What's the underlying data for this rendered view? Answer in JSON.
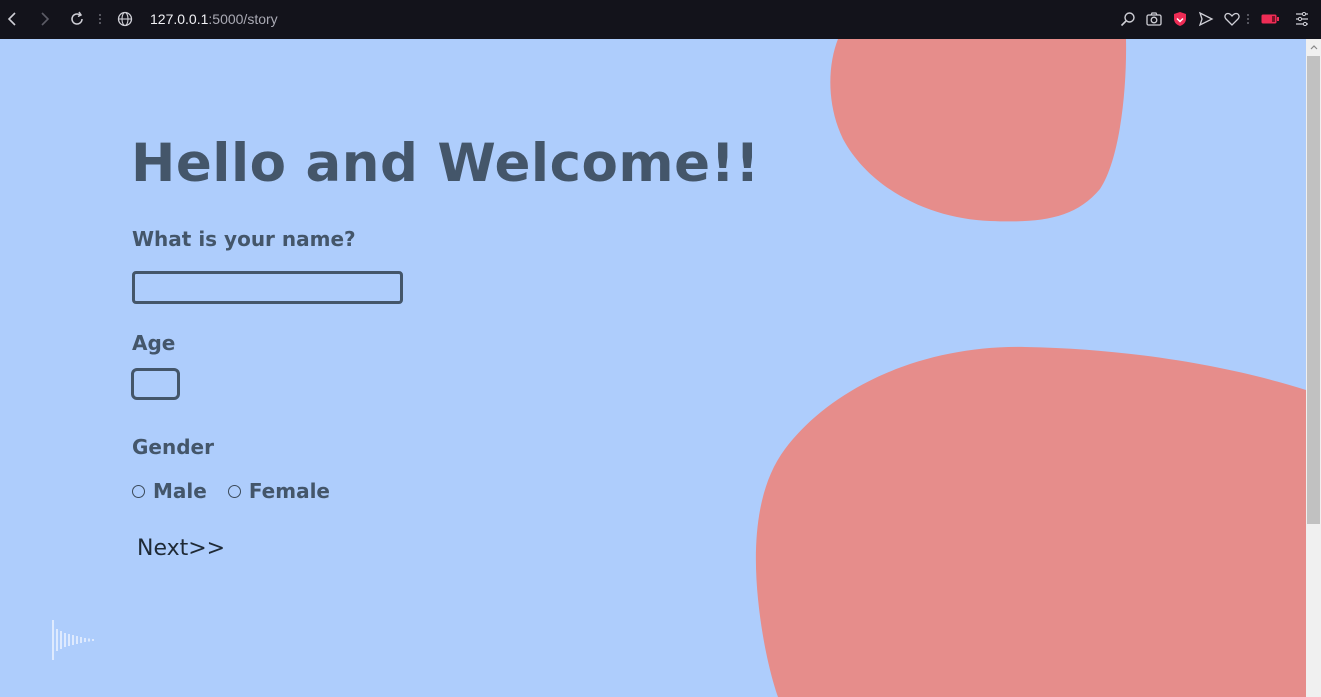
{
  "browser": {
    "url_host": "127.0.0.1",
    "url_path": ":5000/story"
  },
  "page": {
    "title": "Hello and Welcome!!",
    "name_label": "What is your name?",
    "name_value": "",
    "age_label": "Age",
    "age_value": "",
    "gender_label": "Gender",
    "gender_options": [
      "Male",
      "Female"
    ],
    "next_label": "Next>>"
  },
  "colors": {
    "background": "#aecdfc",
    "blob": "#e68d8b",
    "text": "#44566a",
    "chrome": "#13131b"
  }
}
